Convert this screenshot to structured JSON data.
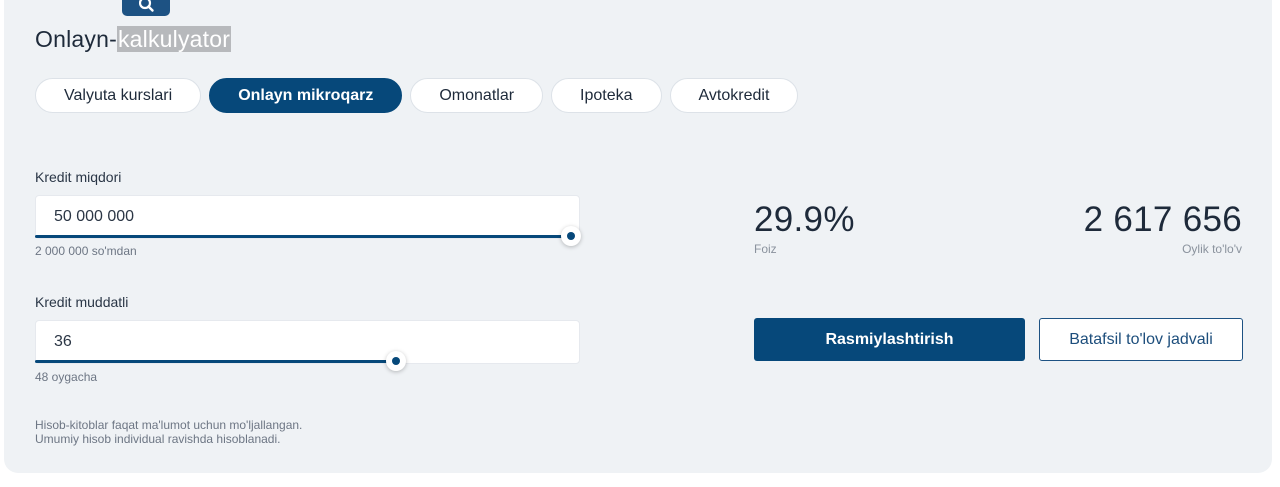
{
  "header": {
    "title_prefix": "Onlayn-",
    "title_selected": "kalkulyator",
    "badge_icon": "search-icon"
  },
  "tabs": [
    {
      "label": "Valyuta kurslari",
      "active": false
    },
    {
      "label": "Onlayn mikroqarz",
      "active": true
    },
    {
      "label": "Omonatlar",
      "active": false
    },
    {
      "label": "Ipoteka",
      "active": false
    },
    {
      "label": "Avtokredit",
      "active": false
    }
  ],
  "amount": {
    "label": "Kredit miqdori",
    "value": "50 000 000",
    "hint": "2 000 000 so'mdan",
    "slider_fraction": 1.0
  },
  "term": {
    "label": "Kredit muddatli",
    "value": "36",
    "hint": "48 oygacha",
    "slider_fraction": 0.75
  },
  "results": {
    "rate_value": "29.9%",
    "rate_label": "Foiz",
    "payment_value": "2 617 656",
    "payment_label": "Oylik to'lo'v"
  },
  "actions": {
    "primary": "Rasmiylashtirish",
    "secondary": "Batafsil to'lov jadvali"
  },
  "disclaimer": {
    "line1": "Hisob-kitoblar faqat ma'lumot uchun mo'ljallangan.",
    "line2": "Umumiy hisob individual ravishda hisoblanadi."
  },
  "colors": {
    "accent": "#06487a",
    "background": "#eff2f5"
  }
}
